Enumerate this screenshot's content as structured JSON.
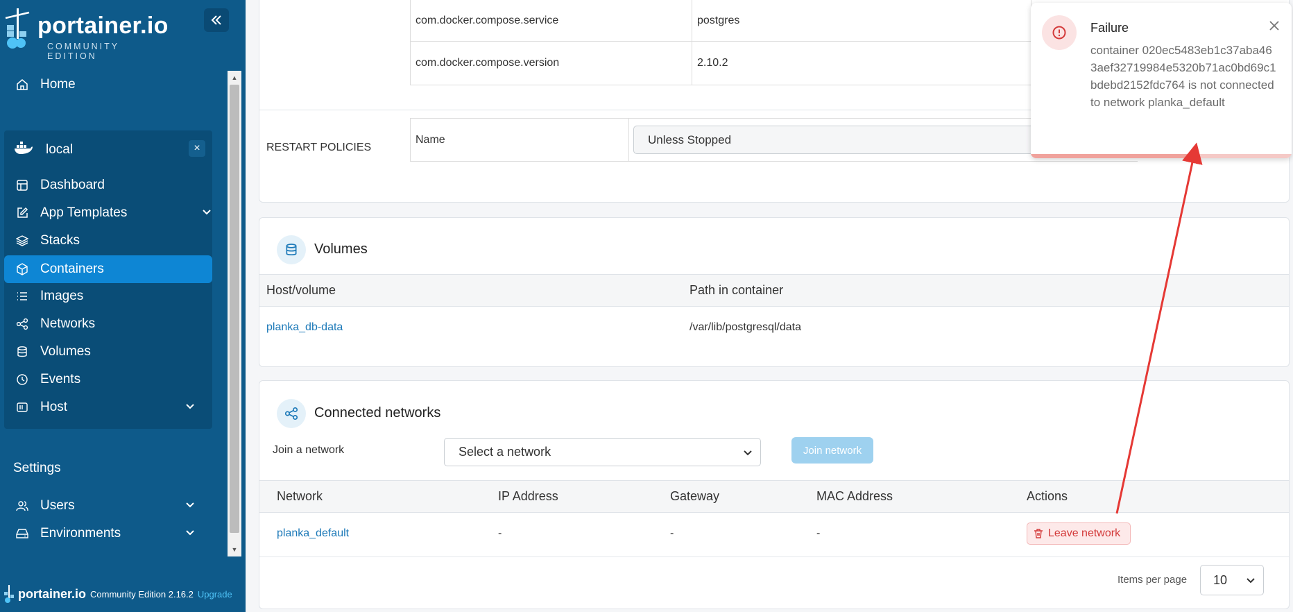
{
  "sidebar": {
    "logo_text": "portainer.io",
    "logo_sub": "COMMUNITY EDITION",
    "collapse_icon": "double-chevron-left-icon",
    "home_label": "Home",
    "environment": {
      "name": "local",
      "close_label": "×",
      "items": [
        {
          "label": "Dashboard",
          "icon": "dashboard-icon"
        },
        {
          "label": "App Templates",
          "icon": "edit-icon",
          "expandable": true
        },
        {
          "label": "Stacks",
          "icon": "layers-icon"
        },
        {
          "label": "Containers",
          "icon": "cube-icon",
          "active": true
        },
        {
          "label": "Images",
          "icon": "list-icon"
        },
        {
          "label": "Networks",
          "icon": "share-icon"
        },
        {
          "label": "Volumes",
          "icon": "database-icon"
        },
        {
          "label": "Events",
          "icon": "clock-icon"
        },
        {
          "label": "Host",
          "icon": "host-icon",
          "expandable": true
        }
      ]
    },
    "settings_title": "Settings",
    "settings_items": [
      {
        "label": "Users",
        "icon": "users-icon",
        "expandable": true
      },
      {
        "label": "Environments",
        "icon": "hdd-icon",
        "expandable": true
      }
    ],
    "footer": {
      "logo_text": "portainer.io",
      "edition": "Community Edition 2.16.2",
      "upgrade_label": "Upgrade"
    }
  },
  "labels_table": [
    {
      "key": "com.docker.compose.service",
      "value": "postgres"
    },
    {
      "key": "com.docker.compose.version",
      "value": "2.10.2"
    }
  ],
  "restart_policies": {
    "section_label": "RESTART POLICIES",
    "name_label": "Name",
    "value": "Unless Stopped"
  },
  "volumes": {
    "title": "Volumes",
    "columns": [
      "Host/volume",
      "Path in container"
    ],
    "rows": [
      {
        "host": "planka_db-data",
        "path": "/var/lib/postgresql/data"
      }
    ]
  },
  "networks": {
    "title": "Connected networks",
    "join_label": "Join a network",
    "select_placeholder": "Select a network",
    "join_button": "Join network",
    "columns": [
      "Network",
      "IP Address",
      "Gateway",
      "MAC Address",
      "Actions"
    ],
    "rows": [
      {
        "network": "planka_default",
        "ip": "-",
        "gateway": "-",
        "mac": "-",
        "action": "Leave network"
      }
    ],
    "items_per_page_label": "Items per page",
    "items_per_page": "10"
  },
  "toast": {
    "title": "Failure",
    "message": "container 020ec5483eb1c37aba463aef32719984e5320b71ac0bd69c1bdebd2152fdc764 is not connected to network planka_default",
    "progress": 0.6,
    "status_color": "#d33a3a"
  },
  "colors": {
    "sidebar": "#0e5a8a",
    "active": "#0e86d4",
    "link": "#1c79b8",
    "annotation_arrow": "#e53935"
  }
}
